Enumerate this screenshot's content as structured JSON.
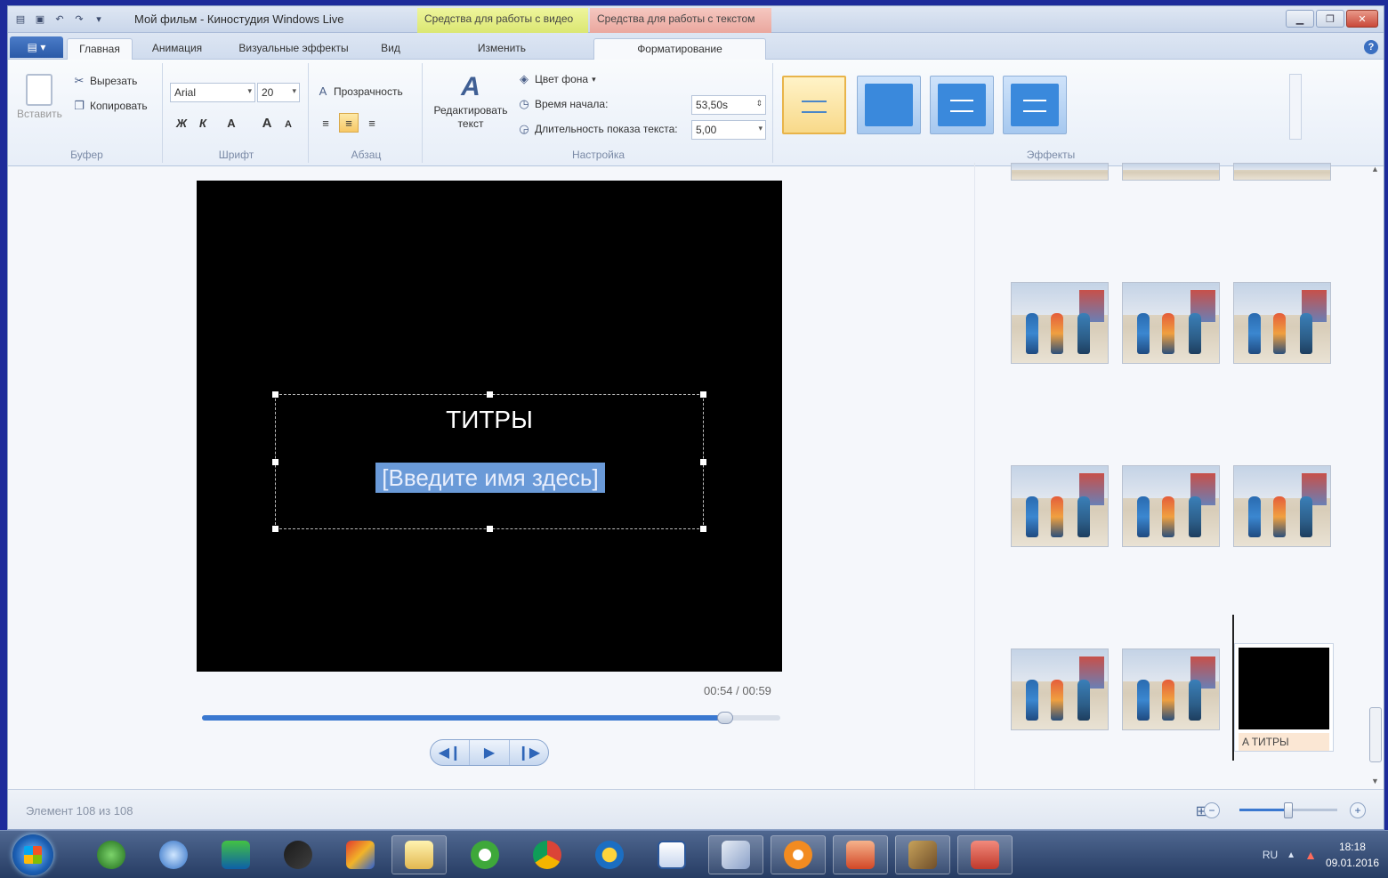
{
  "window": {
    "title": "Мой фильм - Киностудия Windows Live",
    "context_video": "Средства для работы с видео",
    "context_text": "Средства для работы с текстом"
  },
  "tabs": {
    "home": "Главная",
    "animation": "Анимация",
    "visual_effects": "Визуальные эффекты",
    "view": "Вид",
    "edit": "Изменить",
    "format": "Форматирование"
  },
  "ribbon": {
    "clipboard": {
      "paste": "Вставить",
      "cut": "Вырезать",
      "copy": "Копировать",
      "label": "Буфер"
    },
    "font": {
      "family": "Arial",
      "size": "20",
      "bold": "Ж",
      "italic": "К",
      "color": "A",
      "grow": "A",
      "shrink": "A",
      "label": "Шрифт"
    },
    "paragraph": {
      "transparency": "Прозрачность",
      "label": "Абзац"
    },
    "settings": {
      "edit_text": "Редактировать текст",
      "bg_color": "Цвет фона",
      "start_time_label": "Время начала:",
      "start_time_value": "53,50s",
      "duration_label": "Длительность показа текста:",
      "duration_value": "5,00",
      "label": "Настройка"
    },
    "effects": {
      "label": "Эффекты"
    }
  },
  "preview": {
    "title_text": "ТИТРЫ",
    "subtitle_text": "[Введите имя здесь]",
    "time": "00:54 / 00:59",
    "progress": 0.905
  },
  "storyboard": {
    "title_clip_label": "ТИТРЫ"
  },
  "status": {
    "text": "Элемент 108 из 108",
    "zoom": 0.5
  },
  "taskbar": {
    "lang": "RU",
    "time": "18:18",
    "date": "09.01.2016"
  },
  "colors": {
    "accent": "#3a78d0",
    "selection": "#6a9ad8",
    "context_video": "#dbe772",
    "context_text": "#eaa79e"
  }
}
